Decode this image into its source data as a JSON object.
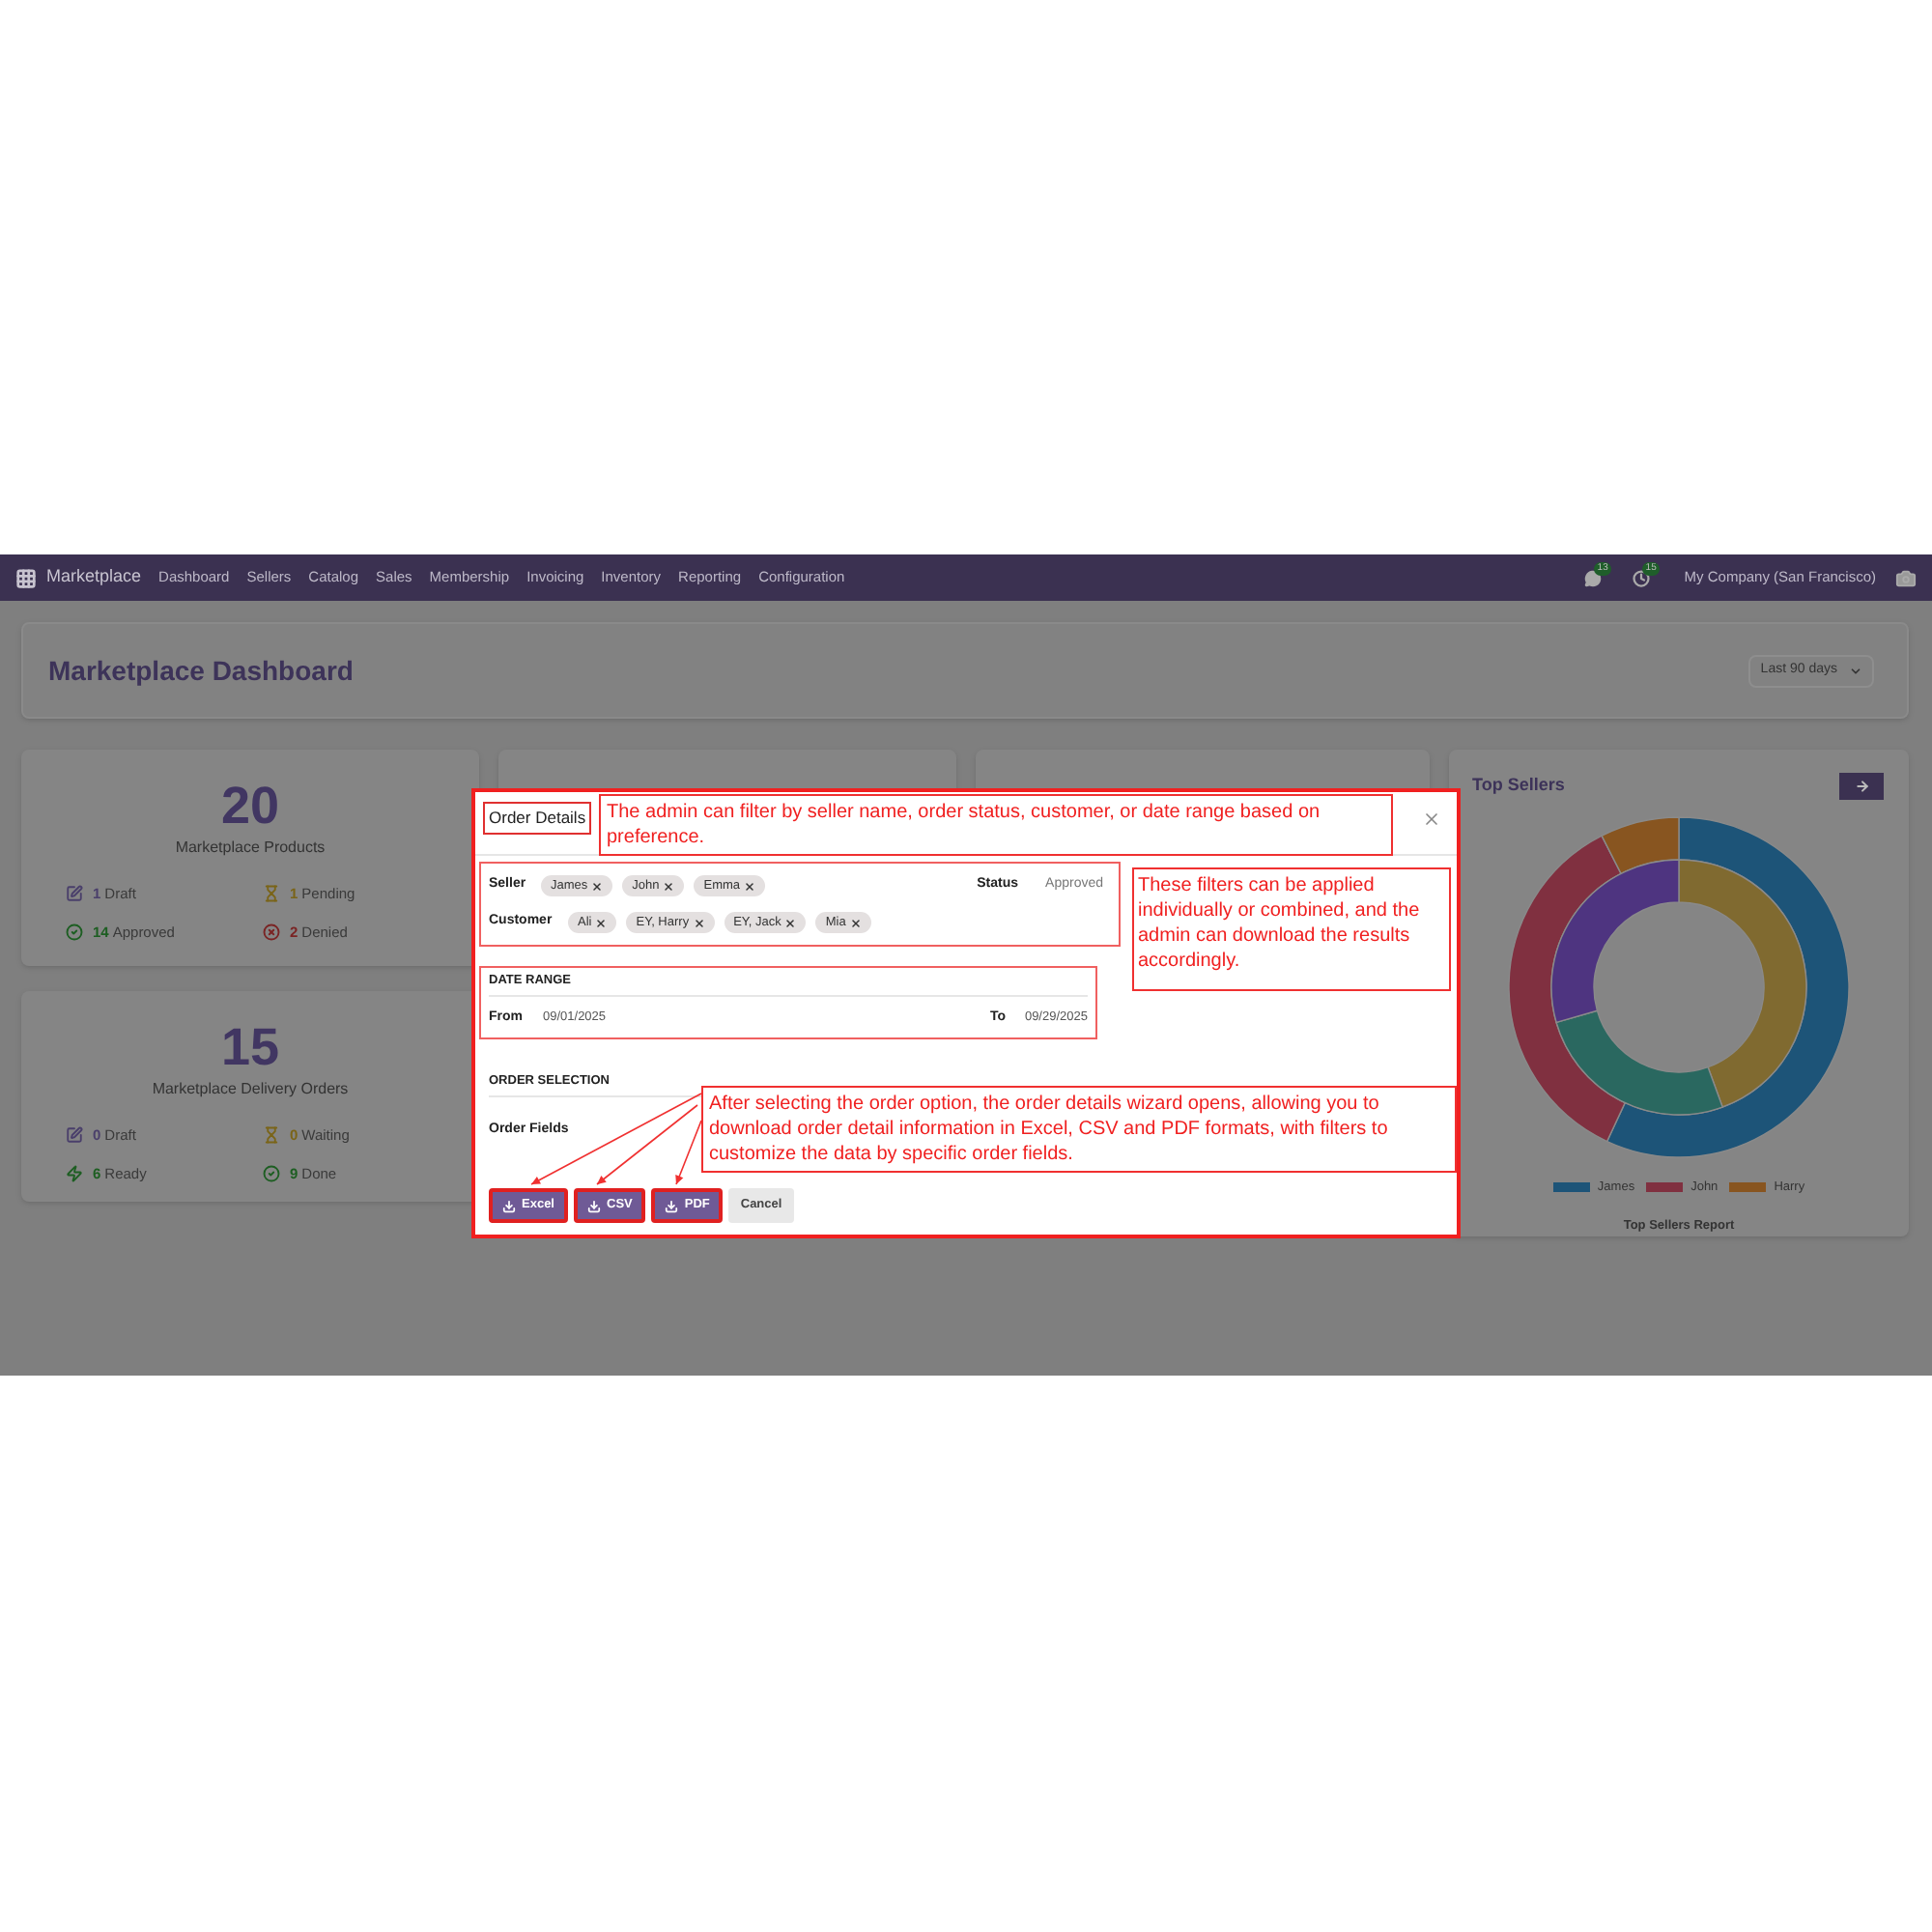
{
  "navbar": {
    "app_name": "Marketplace",
    "menu": [
      "Dashboard",
      "Sellers",
      "Catalog",
      "Sales",
      "Membership",
      "Invoicing",
      "Inventory",
      "Reporting",
      "Configuration"
    ],
    "messages_badge": "13",
    "activities_badge": "15",
    "company": "My Company (San Francisco)"
  },
  "header": {
    "title": "Marketplace Dashboard",
    "period": "Last 90 days"
  },
  "stat_cards": [
    {
      "count": "20",
      "title": "Marketplace Products",
      "stats": [
        {
          "kind": "draft",
          "value": "1",
          "label": "Draft"
        },
        {
          "kind": "pending",
          "value": "1",
          "label": "Pending"
        },
        {
          "kind": "approved",
          "value": "14",
          "label": "Approved"
        },
        {
          "kind": "denied",
          "value": "2",
          "label": "Denied"
        }
      ]
    },
    {
      "count": "15",
      "title": "Marketplace Delivery Orders",
      "stats": [
        {
          "kind": "draft",
          "value": "0",
          "label": "Draft"
        },
        {
          "kind": "pending",
          "value": "0",
          "label": "Waiting"
        },
        {
          "kind": "ready",
          "value": "6",
          "label": "Ready"
        },
        {
          "kind": "approved",
          "value": "9",
          "label": "Done"
        }
      ]
    }
  ],
  "top_sellers": {
    "title": "Top Sellers",
    "legend": [
      {
        "name": "James",
        "color": "#1d5478"
      },
      {
        "name": "John",
        "color": "#803040"
      },
      {
        "name": "Harry",
        "color": "#885520"
      }
    ],
    "caption": "Top Sellers Report"
  },
  "dialog": {
    "title": "Order Details",
    "seller_label": "Seller",
    "sellers": [
      "James",
      "John",
      "Emma"
    ],
    "status_label": "Status",
    "status": "Approved",
    "customer_label": "Customer",
    "customers": [
      "Ali",
      "EY, Harry",
      "EY, Jack",
      "Mia"
    ],
    "date_range_heading": "DATE RANGE",
    "from_label": "From",
    "from": "09/01/2025",
    "to_label": "To",
    "to": "09/29/2025",
    "order_selection_heading": "ORDER SELECTION",
    "order_fields_label": "Order Fields",
    "buttons": [
      {
        "kind": "download",
        "label": "Excel"
      },
      {
        "kind": "download",
        "label": "CSV"
      },
      {
        "kind": "download",
        "label": "PDF"
      },
      {
        "kind": "cancel",
        "label": "Cancel"
      }
    ]
  },
  "annotations": [
    "The admin can filter by seller name, order status, customer, or date range based on preference.",
    "These filters can be applied individually or combined, and the admin can download the results accordingly.",
    "After selecting the order option, the order details wizard opens, allowing you to download order detail information in Excel, CSV and PDF formats, with filters to customize the data by specific order fields."
  ]
}
